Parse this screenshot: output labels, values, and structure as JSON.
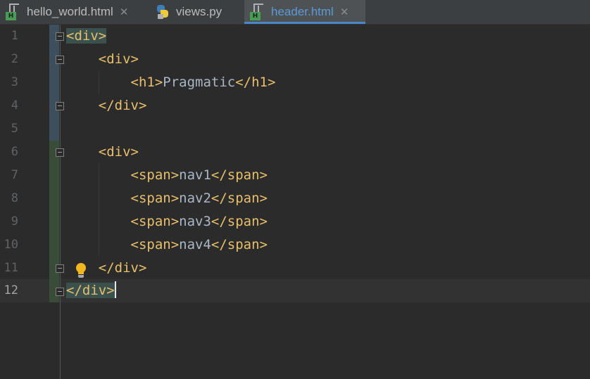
{
  "tabs": [
    {
      "label": "hello_world.html",
      "icon": "html-file-icon",
      "active": false,
      "close": "✕"
    },
    {
      "label": "views.py",
      "icon": "python-file-icon",
      "active": false,
      "close": ""
    },
    {
      "label": "header.html",
      "icon": "html-file-icon",
      "active": true,
      "close": "✕"
    }
  ],
  "editor": {
    "current_line": 12,
    "lines": [
      {
        "num": "1",
        "indent": "",
        "open": "<div>",
        "text": "",
        "close": ""
      },
      {
        "num": "2",
        "indent": "    ",
        "open": "<div>",
        "text": "",
        "close": ""
      },
      {
        "num": "3",
        "indent": "        ",
        "open": "<h1>",
        "text": "Pragmatic",
        "close": "</h1>"
      },
      {
        "num": "4",
        "indent": "    ",
        "open": "</div>",
        "text": "",
        "close": ""
      },
      {
        "num": "5",
        "indent": "",
        "open": "",
        "text": "",
        "close": ""
      },
      {
        "num": "6",
        "indent": "    ",
        "open": "<div>",
        "text": "",
        "close": ""
      },
      {
        "num": "7",
        "indent": "        ",
        "open": "<span>",
        "text": "nav1",
        "close": "</span>"
      },
      {
        "num": "8",
        "indent": "        ",
        "open": "<span>",
        "text": "nav2",
        "close": "</span>"
      },
      {
        "num": "9",
        "indent": "        ",
        "open": "<span>",
        "text": "nav3",
        "close": "</span>"
      },
      {
        "num": "10",
        "indent": "        ",
        "open": "<span>",
        "text": "nav4",
        "close": "</span>"
      },
      {
        "num": "11",
        "indent": "    ",
        "open": "</div>",
        "text": "",
        "close": ""
      },
      {
        "num": "12",
        "indent": "",
        "open": "</div>",
        "text": "",
        "close": ""
      }
    ]
  },
  "colors": {
    "background": "#2b2b2b",
    "tag": "#e8bf6a",
    "text": "#a9b7c6",
    "active_tab_underline": "#4a88c7",
    "changed_block_blue": "#3d4f5c",
    "changed_block_green": "#384c38"
  }
}
